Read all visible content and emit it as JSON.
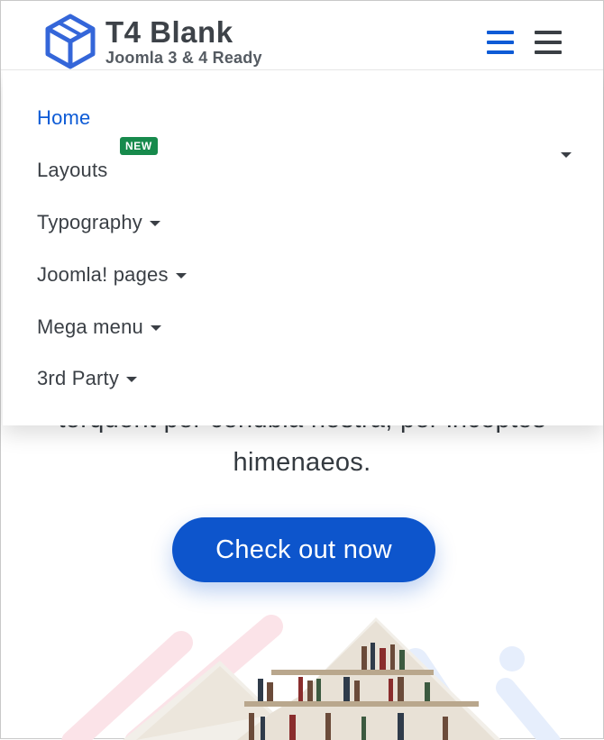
{
  "header": {
    "logo_title": "T4 Blank",
    "logo_subtitle": "Joomla 3 & 4 Ready",
    "menu_toggle_icon": "hamburger-icon",
    "offcanvas_toggle_icon": "hamburger-icon"
  },
  "nav": {
    "items": [
      {
        "label": "Home",
        "active": true,
        "has_dropdown": false
      },
      {
        "label": "Layouts",
        "badge": "NEW",
        "has_dropdown": true
      },
      {
        "label": "Typography",
        "has_dropdown": true
      },
      {
        "label": "Joomla! pages",
        "has_dropdown": true
      },
      {
        "label": "Mega menu",
        "has_dropdown": true
      },
      {
        "label": "3rd Party",
        "has_dropdown": true
      }
    ]
  },
  "hero": {
    "text_line_1": "torquent per conubia nostra, per inceptos",
    "text_line_2": "himenaeos.",
    "cta_label": "Check out now"
  },
  "colors": {
    "primary": "#0d55cc",
    "active_link": "#0d5bd6",
    "badge_green": "#178a4c",
    "text_dark": "#3a3f45"
  }
}
